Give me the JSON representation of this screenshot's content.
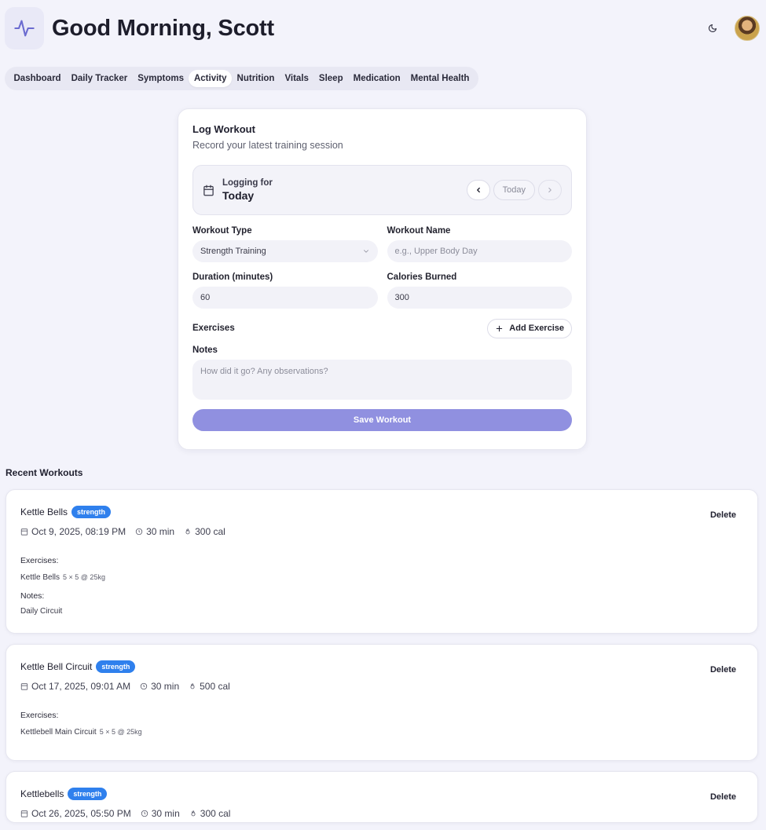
{
  "header": {
    "greeting": "Good Morning, Scott",
    "logo_icon": "activity-icon",
    "theme_icon": "moon-icon",
    "avatar": "user-avatar"
  },
  "tabs": [
    {
      "label": "Dashboard",
      "active": false
    },
    {
      "label": "Daily Tracker",
      "active": false
    },
    {
      "label": "Symptoms",
      "active": false
    },
    {
      "label": "Activity",
      "active": true
    },
    {
      "label": "Nutrition",
      "active": false
    },
    {
      "label": "Vitals",
      "active": false
    },
    {
      "label": "Sleep",
      "active": false
    },
    {
      "label": "Medication",
      "active": false
    },
    {
      "label": "Mental Health",
      "active": false
    }
  ],
  "form": {
    "title": "Log Workout",
    "subtitle": "Record your latest training session",
    "logging_for_label": "Logging for",
    "logging_for_value": "Today",
    "today_button": "Today",
    "workout_type_label": "Workout Type",
    "workout_type_value": "Strength Training",
    "workout_name_label": "Workout Name",
    "workout_name_placeholder": "e.g., Upper Body Day",
    "duration_label": "Duration (minutes)",
    "duration_value": "60",
    "calories_label": "Calories Burned",
    "calories_value": "300",
    "exercises_label": "Exercises",
    "add_exercise_label": "Add Exercise",
    "notes_label": "Notes",
    "notes_placeholder": "How did it go? Any observations?",
    "save_label": "Save Workout"
  },
  "recent": {
    "title": "Recent Workouts",
    "delete_label": "Delete",
    "exercises_heading": "Exercises:",
    "notes_heading": "Notes:",
    "items": [
      {
        "name": "Kettle Bells",
        "type": "strength",
        "date": "Oct 9, 2025, 08:19 PM",
        "duration": "30 min",
        "calories": "300 cal",
        "exercise": "Kettle Bells",
        "exercise_detail": "5 × 5 @ 25kg",
        "notes": "Daily Circuit"
      },
      {
        "name": "Kettle Bell Circuit",
        "type": "strength",
        "date": "Oct 17, 2025, 09:01 AM",
        "duration": "30 min",
        "calories": "500 cal",
        "exercise": "Kettlebell Main Circuit",
        "exercise_detail": "5 × 5 @ 25kg"
      },
      {
        "name": "Kettlebells",
        "type": "strength",
        "date": "Oct 26, 2025, 05:50 PM",
        "duration": "30 min",
        "calories": "300 cal"
      }
    ]
  },
  "colors": {
    "accent": "#9090e0",
    "badge": "#2f80ed",
    "background": "#f3f3fb"
  }
}
